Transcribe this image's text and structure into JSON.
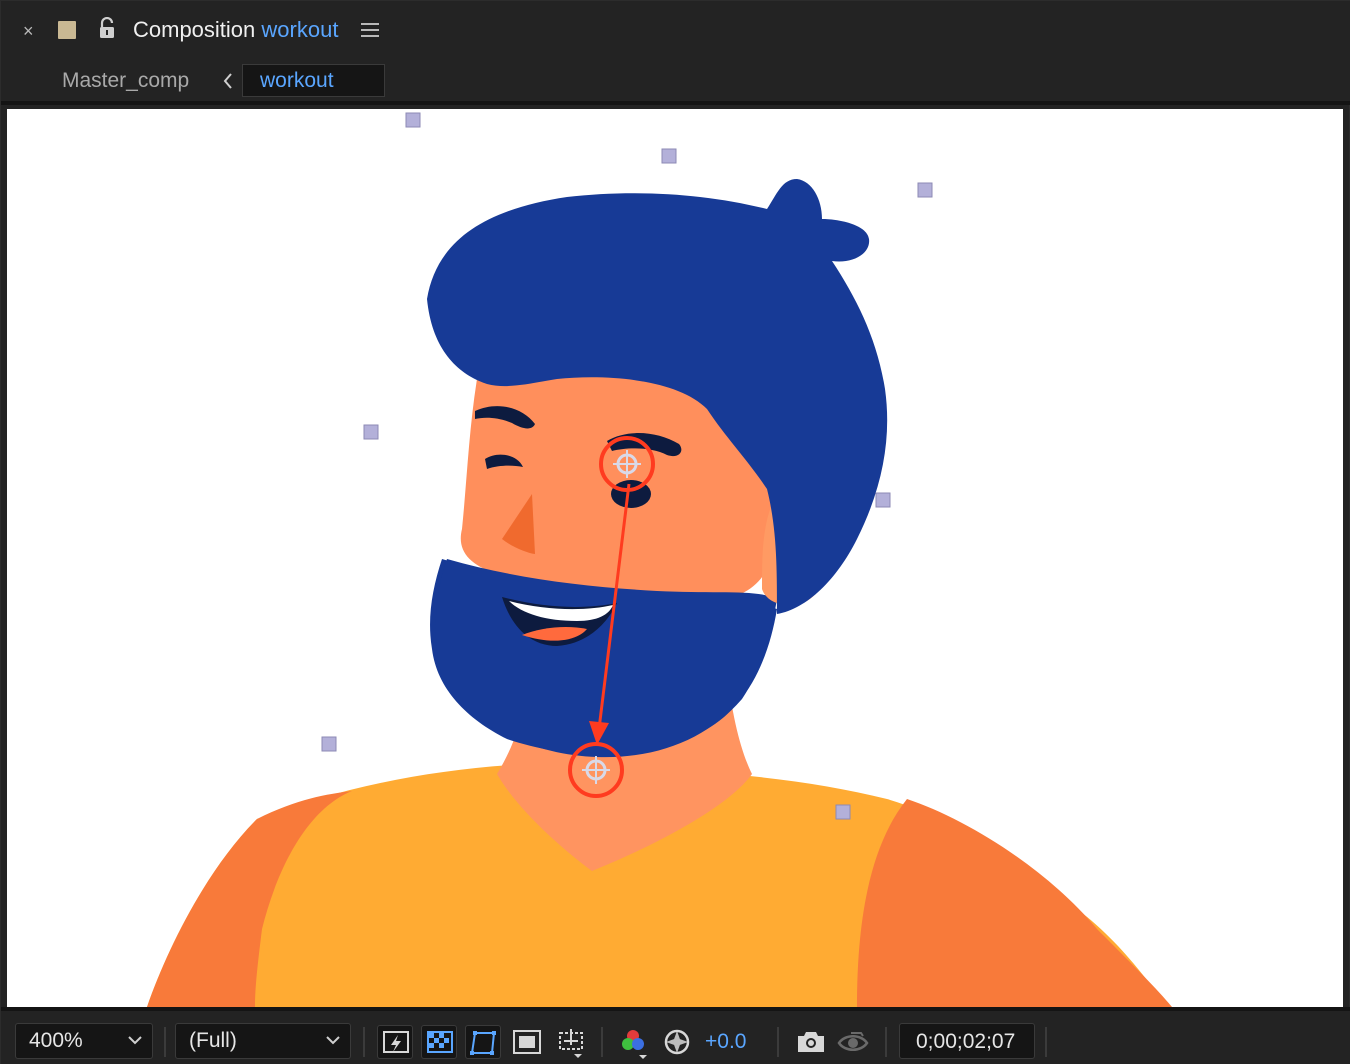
{
  "header": {
    "close_symbol": "×",
    "title_prefix": "Composition",
    "title_comp": "workout",
    "lock_icon": "unlock-icon",
    "menu_icon": "hamburger-menu-icon",
    "swatch_color": "#c9b893"
  },
  "breadcrumb": {
    "parent": "Master_comp",
    "current": "workout"
  },
  "viewer": {
    "background": "#ffffff",
    "character_colors": {
      "hair": "#173a96",
      "skin": "#ff8f5c",
      "shirt": "#ffab33",
      "shoulder": "#f87a3a",
      "annotation": "#ff3b1f"
    }
  },
  "bottom_bar": {
    "magnification": "400%",
    "resolution": "(Full)",
    "exposure": "+0.0",
    "timecode": "0;00;02;07",
    "icons": [
      "fast-preview-icon",
      "transparency-grid-icon",
      "mask-visibility-icon",
      "region-of-interest-icon",
      "grid-guides-icon",
      "channel-icon",
      "exposure-reset-icon",
      "snapshot-icon",
      "show-snapshot-icon"
    ]
  },
  "accent_color": "#5aa6ff"
}
